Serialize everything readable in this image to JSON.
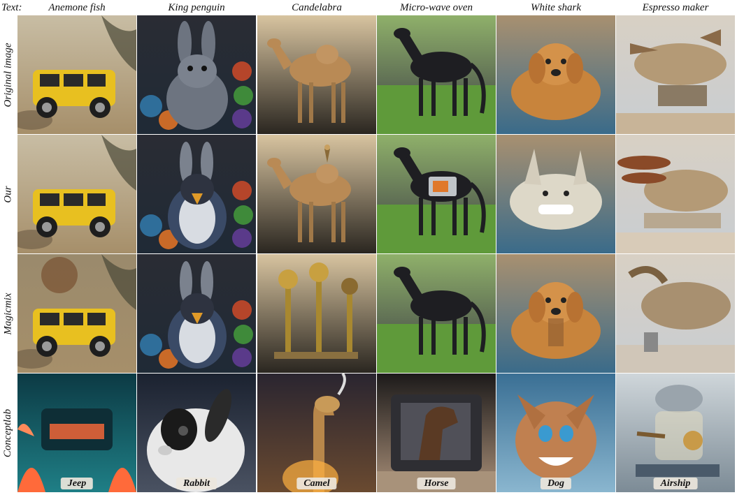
{
  "text_label": "Text:",
  "columns": [
    {
      "text": "Anemone fish",
      "concept": "Jeep"
    },
    {
      "text": "King penguin",
      "concept": "Rabbit"
    },
    {
      "text": "Candelabra",
      "concept": "Camel"
    },
    {
      "text": "Micro-wave oven",
      "concept": "Horse"
    },
    {
      "text": "White shark",
      "concept": "Dog"
    },
    {
      "text": "Espresso maker",
      "concept": "Airship"
    }
  ],
  "rows": [
    {
      "label": "Original image"
    },
    {
      "label": "Our"
    },
    {
      "label": "Magicmix"
    },
    {
      "label": "Conceptlab"
    }
  ],
  "palette": {
    "jeep_yellow": "#e8c020",
    "rabbit_gray": "#6d7480",
    "camel_tan": "#b98a55",
    "horse_black": "#1e1e22",
    "grass_green": "#5f9a3a",
    "dog_golden": "#c8843c",
    "airship_bronze": "#b49a76",
    "underwater_teal": "#1f6f78"
  }
}
